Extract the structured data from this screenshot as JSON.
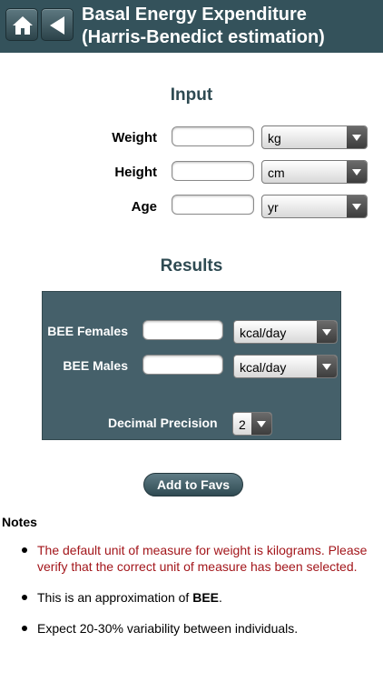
{
  "header": {
    "title_line1": "Basal Energy Expenditure",
    "title_line2": "(Harris-Benedict estimation)",
    "home_icon": "home-icon",
    "back_icon": "back-arrow-icon"
  },
  "input": {
    "title": "Input",
    "rows": [
      {
        "label": "Weight",
        "value": "",
        "unit": "kg"
      },
      {
        "label": "Height",
        "value": "",
        "unit": "cm"
      },
      {
        "label": "Age",
        "value": "",
        "unit": "yr"
      }
    ]
  },
  "results": {
    "title": "Results",
    "rows": [
      {
        "label": "BEE Females",
        "value": "",
        "unit": "kcal/day"
      },
      {
        "label": "BEE Males",
        "value": "",
        "unit": "kcal/day"
      }
    ],
    "precision_label": "Decimal Precision",
    "precision_value": "2"
  },
  "favs_button": "Add to Favs",
  "notes": {
    "title": "Notes",
    "items": [
      "The default unit of measure for weight is kilograms. Please verify that the correct unit of measure has been selected.",
      "This is an approximation of ",
      "Expect 20-30% variability between individuals."
    ],
    "bold_term": "BEE",
    "bold_suffix": "."
  },
  "colors": {
    "header_bg": "#34525b",
    "panel_bg": "#45606a",
    "section_title": "#2e4a52",
    "warning_text": "#a3161b"
  }
}
